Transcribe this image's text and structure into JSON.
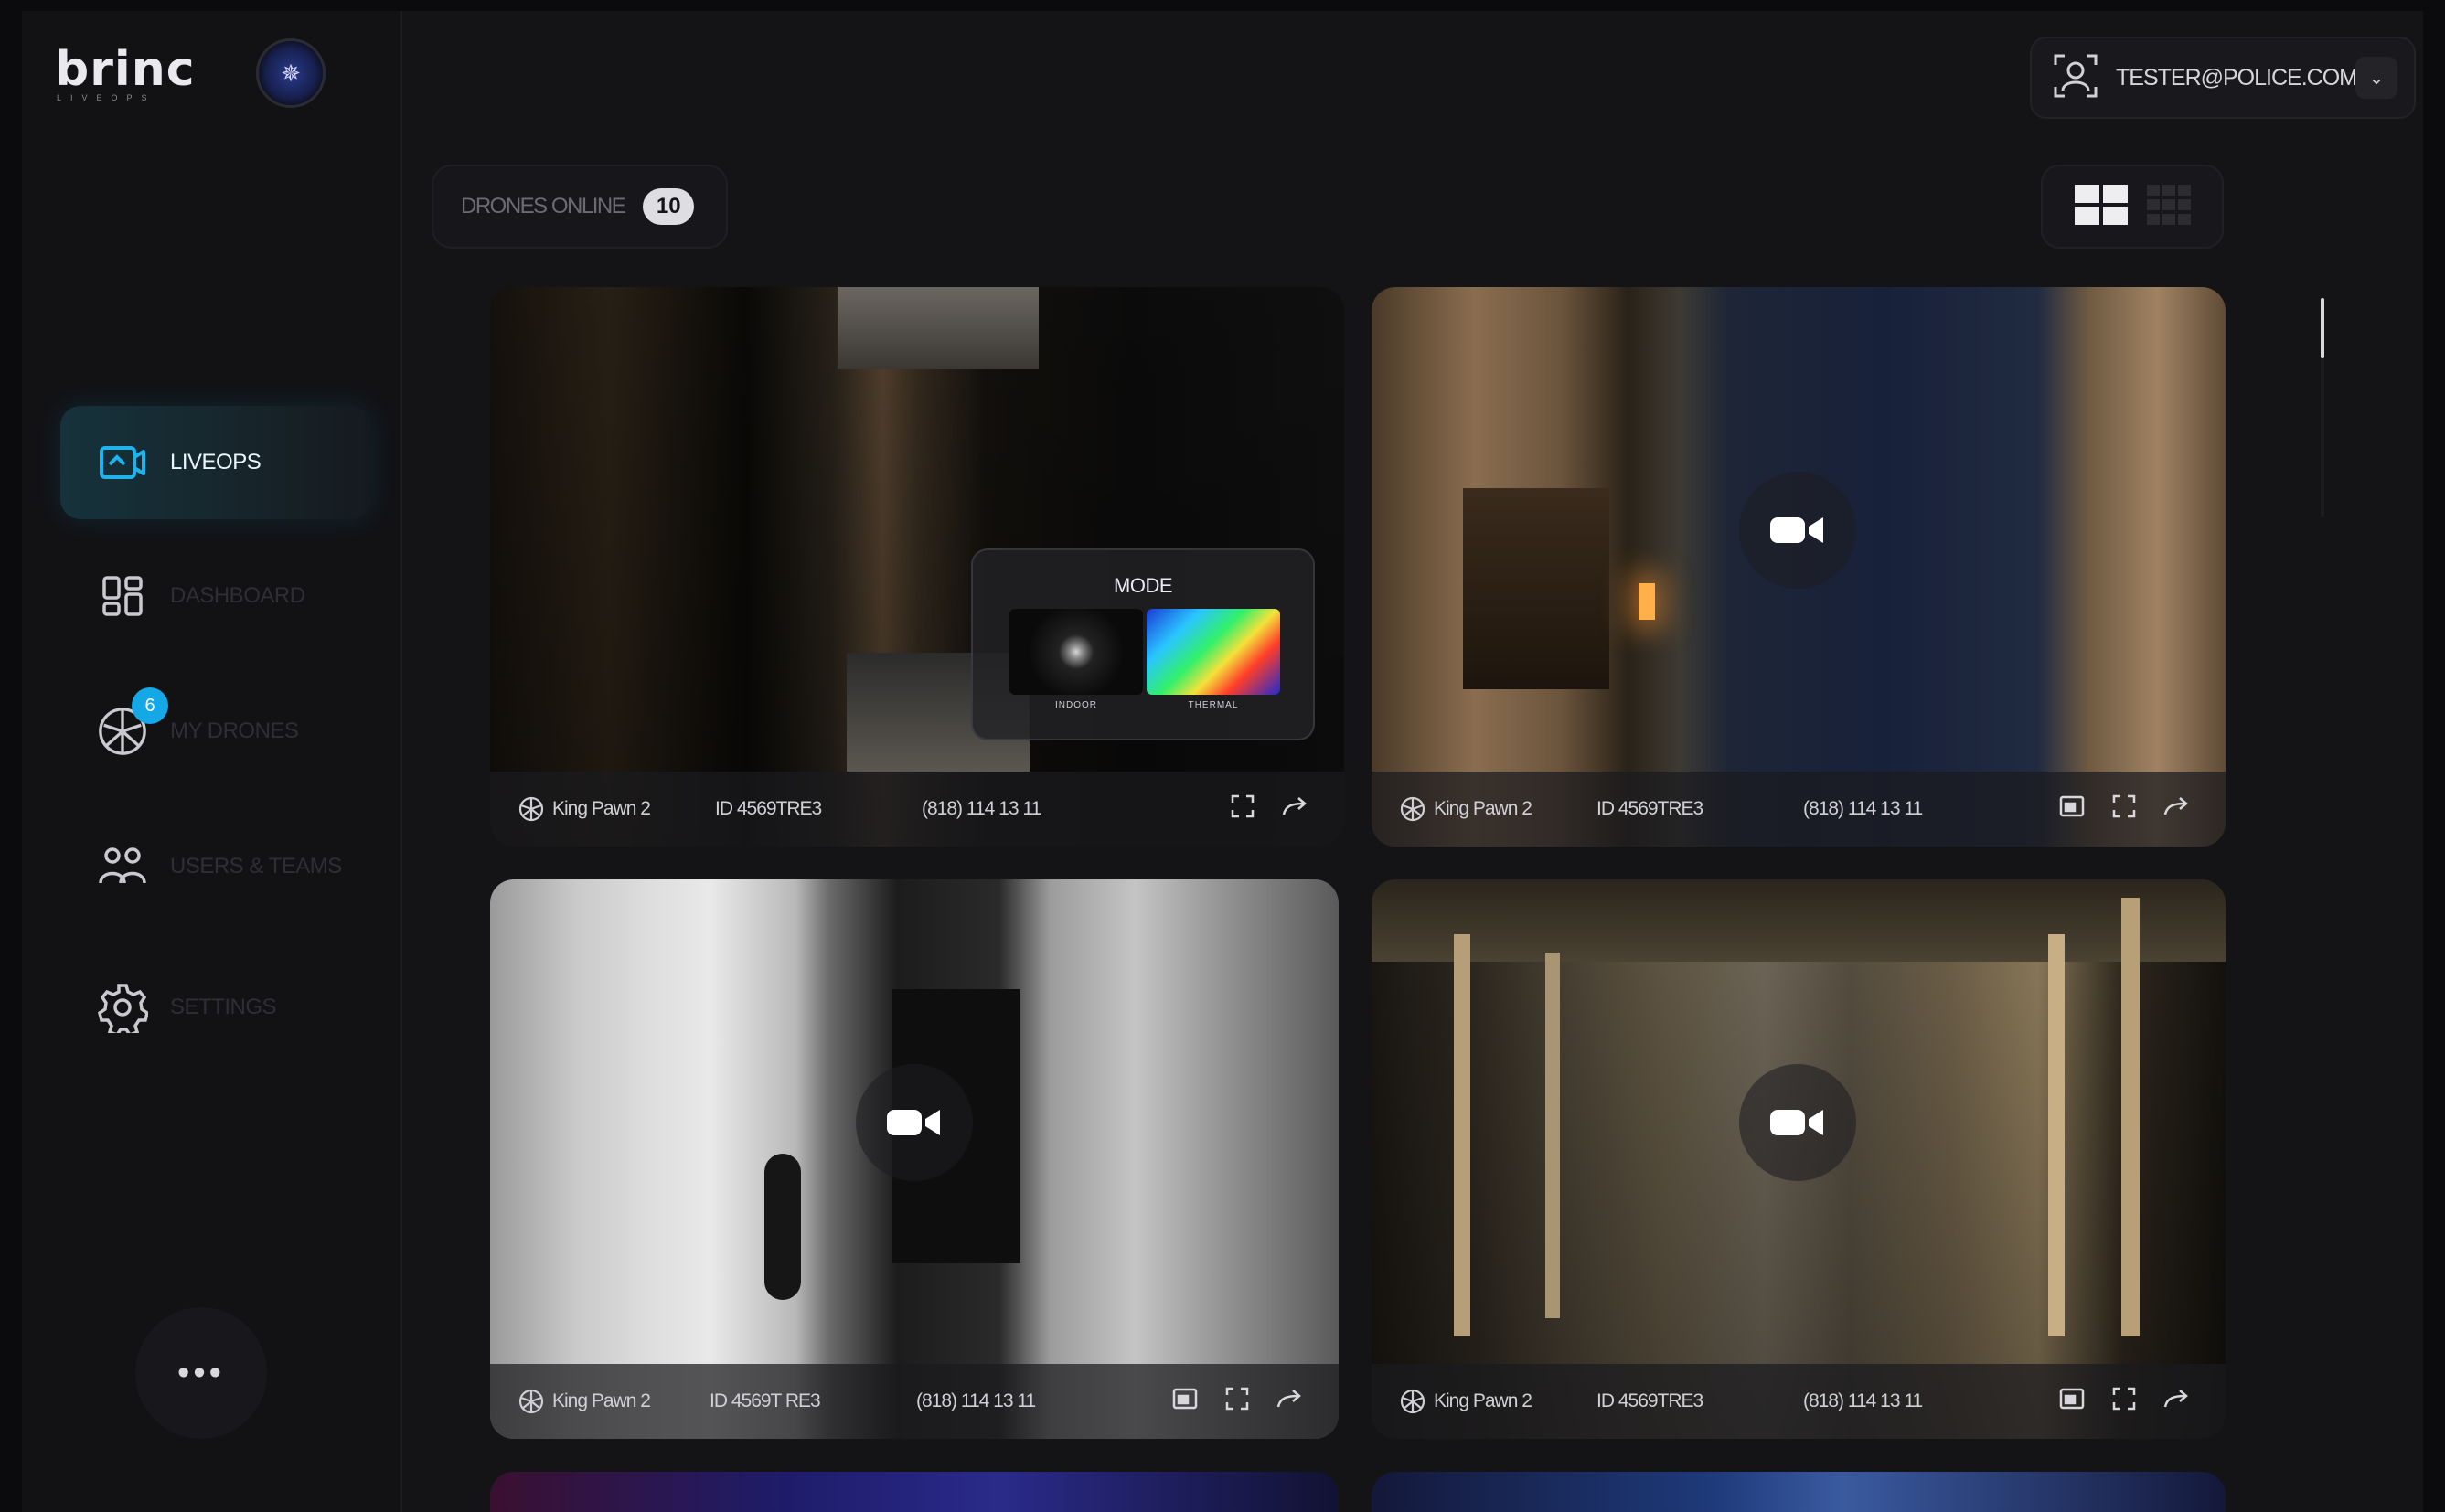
{
  "brand": {
    "name": "brinc",
    "subline": "LIVEOPS"
  },
  "user": {
    "email": "TESTER@POLICE.COM"
  },
  "nav": {
    "items": [
      {
        "label": "LIVEOPS",
        "icon": "liveops-icon",
        "active": true
      },
      {
        "label": "DASHBOARD",
        "icon": "dashboard-icon",
        "active": false
      },
      {
        "label": "MY DRONES",
        "icon": "drone-icon",
        "active": false,
        "badge": "6"
      },
      {
        "label": "USERS & TEAMS",
        "icon": "users-icon",
        "active": false
      },
      {
        "label": "SETTINGS",
        "icon": "gear-icon",
        "active": false
      }
    ],
    "more_label": "•••"
  },
  "toolbar": {
    "drones_online_label": "DRONES ONLINE",
    "drones_online_count": "10"
  },
  "mode_popup": {
    "title": "MODE",
    "options": [
      "INDOOR",
      "THERMAL"
    ]
  },
  "feeds": [
    {
      "name": "King Pawn 2",
      "id": "ID 4569TRE3",
      "phone": "(818) 114 13 11"
    },
    {
      "name": "King Pawn 2",
      "id": "ID 4569TRE3",
      "phone": "(818) 114 13 11"
    },
    {
      "name": "King Pawn 2",
      "id": "ID 4569T RE3",
      "phone": "(818) 114 13 11"
    },
    {
      "name": "King Pawn 2",
      "id": "ID 4569TRE3",
      "phone": "(818) 114 13 11"
    }
  ],
  "colors": {
    "accent": "#14a8e6",
    "background": "#141417",
    "active_nav": "#16323c"
  }
}
